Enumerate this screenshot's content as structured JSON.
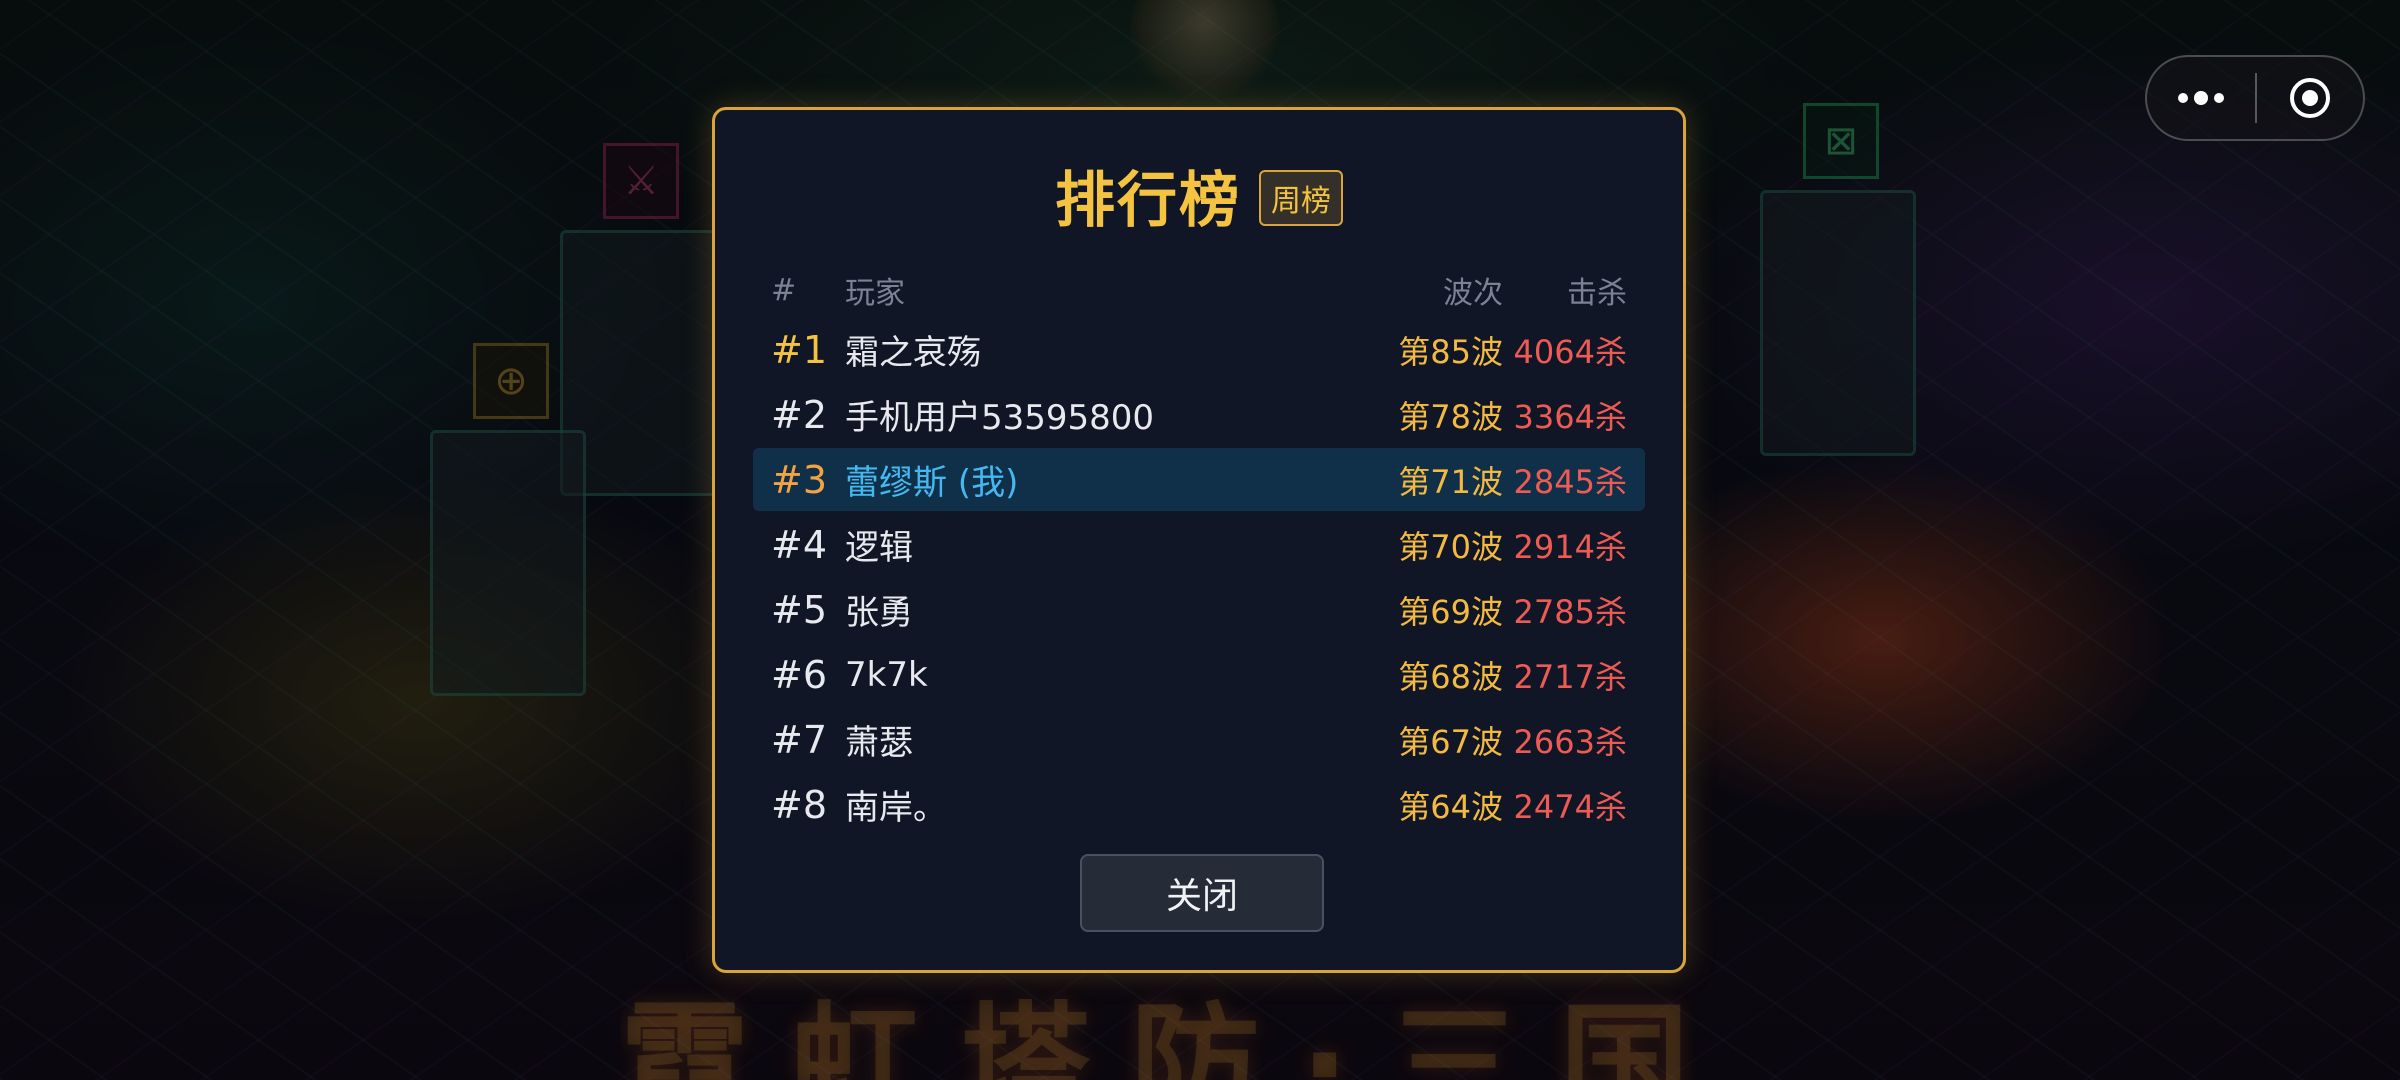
{
  "background": {
    "title_text": "霓虹塔防·三国"
  },
  "capsule": {
    "more_icon": "more-dots-icon",
    "close_icon": "target-circle-icon"
  },
  "leaderboard": {
    "title": "排行榜",
    "badge": "周榜",
    "headers": {
      "rank": "#",
      "player": "玩家",
      "wave": "波次",
      "kills": "击杀"
    },
    "rows": [
      {
        "rank": "#1",
        "name": "霜之哀殇",
        "wave": "第85波",
        "kills": "4064杀",
        "me": false
      },
      {
        "rank": "#2",
        "name": "手机用户53595800",
        "wave": "第78波",
        "kills": "3364杀",
        "me": false
      },
      {
        "rank": "#3",
        "name": "蕾缪斯 (我)",
        "wave": "第71波",
        "kills": "2845杀",
        "me": true
      },
      {
        "rank": "#4",
        "name": "逻辑",
        "wave": "第70波",
        "kills": "2914杀",
        "me": false
      },
      {
        "rank": "#5",
        "name": "张勇",
        "wave": "第69波",
        "kills": "2785杀",
        "me": false
      },
      {
        "rank": "#6",
        "name": "7k7k",
        "wave": "第68波",
        "kills": "2717杀",
        "me": false
      },
      {
        "rank": "#7",
        "name": "萧瑟",
        "wave": "第67波",
        "kills": "2663杀",
        "me": false
      },
      {
        "rank": "#8",
        "name": "南岸。",
        "wave": "第64波",
        "kills": "2474杀",
        "me": false
      }
    ],
    "close_label": "关闭"
  },
  "colors": {
    "gold": "#f3c341",
    "wave": "#f3b941",
    "kills": "#ee5b55",
    "me_name": "#45b8f0",
    "border": "#d9a53a"
  }
}
